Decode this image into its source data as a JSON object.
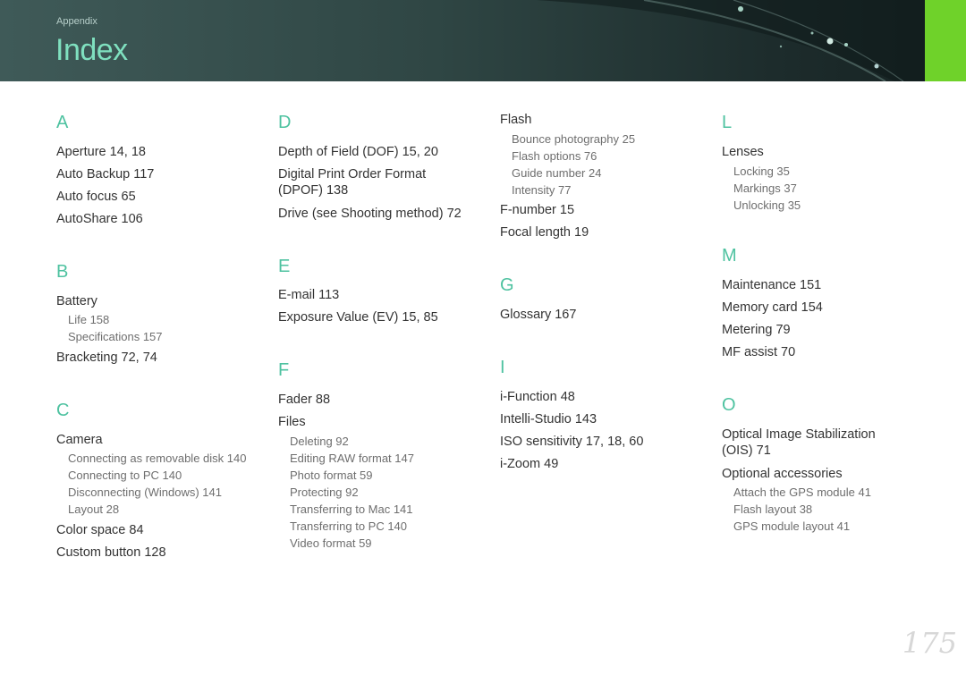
{
  "header": {
    "section": "Appendix",
    "title": "Index"
  },
  "page_number": "175",
  "index": {
    "A": {
      "letter": "A",
      "items": [
        "Aperture  14, 18",
        "Auto Backup  117",
        "Auto focus  65",
        "AutoShare  106"
      ]
    },
    "B": {
      "letter": "B",
      "battery": "Battery",
      "battery_subs": [
        "Life  158",
        "Specifications  157"
      ],
      "bracketing": "Bracketing  72, 74"
    },
    "C": {
      "letter": "C",
      "camera": "Camera",
      "camera_subs": [
        "Connecting as removable disk  140",
        "Connecting to PC  140",
        "Disconnecting (Windows)  141",
        "Layout  28"
      ],
      "items": [
        "Color space  84",
        "Custom button  128"
      ]
    },
    "D": {
      "letter": "D",
      "dof": "Depth of Field (DOF)  15, 20",
      "dpof_1": "Digital Print Order Format",
      "dpof_2": "(DPOF)  138",
      "drive": "Drive (see Shooting method)  72"
    },
    "E": {
      "letter": "E",
      "items": [
        "E-mail  113",
        "Exposure Value (EV)  15, 85"
      ]
    },
    "F": {
      "letter": "F",
      "fader": "Fader  88",
      "files": "Files",
      "files_subs": [
        "Deleting  92",
        "Editing RAW format  147",
        "Photo format  59",
        "Protecting  92",
        "Transferring to Mac  141",
        "Transferring to PC  140",
        "Video format  59"
      ],
      "flash": "Flash",
      "flash_subs": [
        "Bounce photography  25",
        "Flash options  76",
        "Guide number  24",
        "Intensity  77"
      ],
      "items": [
        "F-number  15",
        "Focal length  19"
      ]
    },
    "G": {
      "letter": "G",
      "items": [
        "Glossary  167"
      ]
    },
    "I": {
      "letter": "I",
      "items": [
        "i-Function  48",
        "Intelli-Studio  143",
        "ISO sensitivity  17, 18, 60",
        "i-Zoom  49"
      ]
    },
    "L": {
      "letter": "L",
      "lenses": "Lenses",
      "lenses_subs": [
        "Locking  35",
        "Markings  37",
        "Unlocking  35"
      ]
    },
    "M": {
      "letter": "M",
      "items": [
        "Maintenance  151",
        "Memory card  154",
        "Metering  79",
        "MF assist  70"
      ]
    },
    "O": {
      "letter": "O",
      "ois_1": "Optical Image Stabilization",
      "ois_2": "(OIS)  71",
      "accessories": "Optional accessories",
      "accessories_subs": [
        "Attach the GPS module  41",
        "Flash layout  38",
        "GPS module layout  41"
      ]
    }
  }
}
